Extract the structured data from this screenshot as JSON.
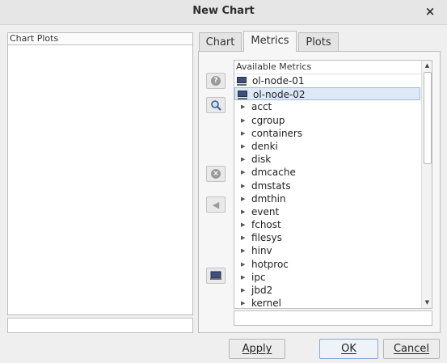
{
  "window": {
    "title": "New Chart",
    "close_glyph": "×"
  },
  "left": {
    "list_header": "Chart Plots"
  },
  "tabs": [
    {
      "label": "Chart",
      "active": false
    },
    {
      "label": "Metrics",
      "active": true
    },
    {
      "label": "Plots",
      "active": false
    }
  ],
  "metrics": {
    "header": "Available Metrics",
    "hosts": [
      {
        "label": "ol-node-01",
        "icon": "monitor-icon",
        "selected": false
      },
      {
        "label": "ol-node-02",
        "icon": "monitor-icon",
        "selected": true
      }
    ],
    "items": [
      "acct",
      "cgroup",
      "containers",
      "denki",
      "disk",
      "dmcache",
      "dmstats",
      "dmthin",
      "event",
      "fchost",
      "filesys",
      "hinv",
      "hotproc",
      "ipc",
      "jbd2",
      "kernel"
    ]
  },
  "side_buttons": [
    {
      "name": "question-icon",
      "glyph": "?"
    },
    {
      "name": "search-icon",
      "glyph": ""
    },
    {
      "name": "remove-icon",
      "glyph": "×"
    },
    {
      "name": "left-arrow-icon",
      "glyph": "◀"
    },
    {
      "name": "monitor-icon",
      "glyph": ""
    }
  ],
  "buttons": {
    "apply": "Apply",
    "ok": "OK",
    "cancel": "Cancel"
  },
  "colors": {
    "accent": "#9bbbe0",
    "selection": "#dde9f7",
    "host_icon": "#3d4f7a"
  }
}
